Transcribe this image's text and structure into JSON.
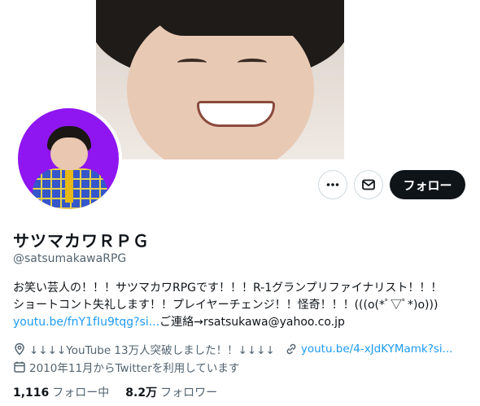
{
  "profile": {
    "display_name": "サツマカワＲＰＧ",
    "handle": "@satsumakawaRPG",
    "bio_line1": "お笑い芸人の！！！サツマカワRPGです！！！R-1グランプリファイナリスト！！！",
    "bio_line2": "ショートコント失礼します！！プレイヤーチェンジ！！怪奇！！！(((o(*ﾟ▽ﾟ*)o)))",
    "bio_link": "youtu.be/fnY1fIu9tqg?si...",
    "bio_contact": "ご連絡→rsatsukawa@yahoo.co.jp",
    "location": "↓↓↓↓YouTube 13万人突破しました！！↓↓↓↓",
    "website": "youtu.be/4-xJdKYMamk?si...",
    "joined": "2010年11月からTwitterを利用しています",
    "following_count": "1,116",
    "following_label": "フォロー中",
    "followers_count": "8.2万",
    "followers_label": "フォロワー"
  },
  "actions": {
    "follow_label": "フォロー",
    "more_icon": "more-icon",
    "mail_icon": "mail-icon"
  },
  "colors": {
    "link": "#1d9bf0",
    "follow_button": "#0f1419",
    "avatar_bg": "#8f16f0"
  }
}
